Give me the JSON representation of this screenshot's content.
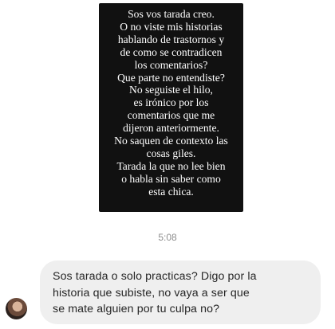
{
  "story": {
    "lines": [
      "Sos vos tarada creo.",
      "O no viste mis historias",
      "hablando de trastornos y",
      "de como se contradicen",
      "los comentarios?",
      "Que parte no entendiste?",
      "No seguiste el hilo,",
      "es irónico por los",
      "comentarios que me",
      "dijeron anteriormente.",
      "No saquen de contexto las",
      "cosas giles.",
      "Tarada la que no lee bien",
      "o habla sin saber como",
      "esta chica."
    ]
  },
  "timestamp": "5:08",
  "message": {
    "lines": [
      "Sos tarada o solo practicas? Digo por la",
      "historia que subiste, no vaya a ser que",
      "se mate alguien por tu culpa no?"
    ]
  },
  "colors": {
    "story_bg": "#111111",
    "bubble_bg": "#efefef",
    "timestamp": "#8e8e8e"
  }
}
